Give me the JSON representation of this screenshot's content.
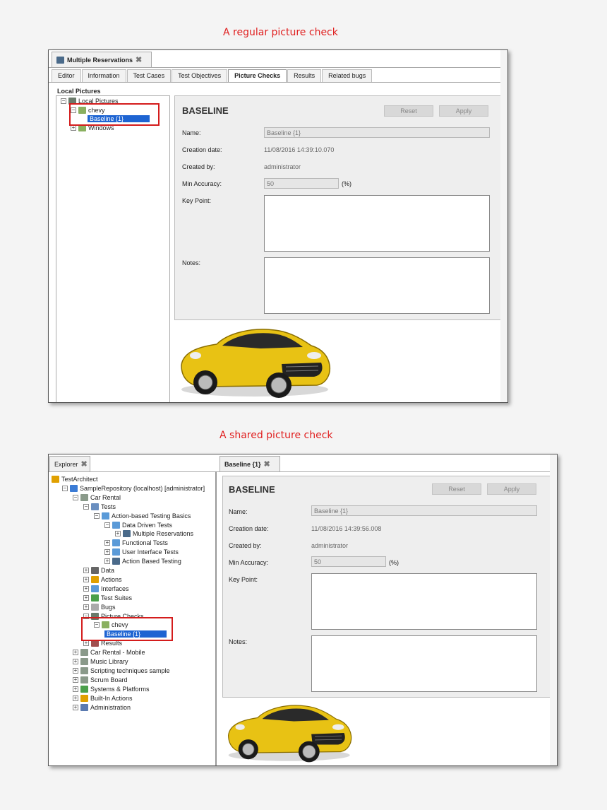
{
  "top": {
    "caption": "A regular picture check",
    "window_tab": "Multiple Reservations",
    "tabs": [
      "Editor",
      "Information",
      "Test Cases",
      "Test Objectives",
      "Picture Checks",
      "Results",
      "Related bugs"
    ],
    "active_tab": "Picture Checks",
    "panel_title": "Local Pictures",
    "tree": {
      "root": "Local Pictures",
      "folder": "chevy",
      "selected": "Baseline {1}",
      "other": "Windows"
    },
    "detail": {
      "heading": "BASELINE",
      "reset": "Reset",
      "apply": "Apply",
      "name_label": "Name:",
      "name_value": "Baseline {1}",
      "creation_label": "Creation date:",
      "creation_value": "11/08/2016 14:39:10.070",
      "created_by_label": "Created by:",
      "created_by_value": "administrator",
      "accuracy_label": "Min Accuracy:",
      "accuracy_value": "50",
      "percent": "(%)",
      "keypoint_label": "Key Point:",
      "notes_label": "Notes:"
    }
  },
  "bottom": {
    "caption": "A shared picture check",
    "explorer_tab": "Explorer",
    "editor_tab": "Baseline {1}",
    "tree": [
      {
        "label": "TestArchitect",
        "indent": 0,
        "icon": "pen-icon",
        "color": "#e0a000"
      },
      {
        "label": "SampleRepository (localhost) [administrator]",
        "indent": 1,
        "icon": "repository-icon",
        "color": "#3a7bd5"
      },
      {
        "label": "Car Rental",
        "indent": 2,
        "icon": "project-icon",
        "color": "#8a9a8a"
      },
      {
        "label": "Tests",
        "indent": 3,
        "icon": "tests-icon",
        "color": "#6a8fc0"
      },
      {
        "label": "Action-based Testing Basics",
        "indent": 4,
        "icon": "folder-icon",
        "color": "#5a9ad8"
      },
      {
        "label": "Data Driven Tests",
        "indent": 5,
        "icon": "folder-icon",
        "color": "#5a9ad8"
      },
      {
        "label": "Multiple Reservations",
        "indent": 6,
        "icon": "test-module-icon",
        "color": "#4a6a8a"
      },
      {
        "label": "Functional Tests",
        "indent": 5,
        "icon": "folder-icon",
        "color": "#5a9ad8"
      },
      {
        "label": "User Interface Tests",
        "indent": 5,
        "icon": "folder-icon",
        "color": "#5a9ad8"
      },
      {
        "label": "Action Based Testing",
        "indent": 5,
        "icon": "test-module-icon",
        "color": "#4a6a8a"
      },
      {
        "label": "Data",
        "indent": 3,
        "icon": "data-icon",
        "color": "#666666"
      },
      {
        "label": "Actions",
        "indent": 3,
        "icon": "actions-icon",
        "color": "#e0a000"
      },
      {
        "label": "Interfaces",
        "indent": 3,
        "icon": "interfaces-icon",
        "color": "#5a9ad8"
      },
      {
        "label": "Test Suites",
        "indent": 3,
        "icon": "test-suites-icon",
        "color": "#4aa04a"
      },
      {
        "label": "Bugs",
        "indent": 3,
        "icon": "bugs-icon",
        "color": "#aaaaaa"
      },
      {
        "label": "Picture Checks",
        "indent": 3,
        "icon": "picture-checks-icon",
        "color": "#6a7a6a"
      },
      {
        "label": "chevy",
        "indent": 4,
        "icon": "picture-folder-icon",
        "color": "#8ab060"
      },
      {
        "label": "Baseline {1}",
        "indent": 5,
        "icon": "",
        "color": ""
      },
      {
        "label": "Results",
        "indent": 3,
        "icon": "results-icon",
        "color": "#a05050"
      },
      {
        "label": "Car Rental - Mobile",
        "indent": 2,
        "icon": "project-icon",
        "color": "#8a9a8a"
      },
      {
        "label": "Music Library",
        "indent": 2,
        "icon": "project-icon",
        "color": "#8a9a8a"
      },
      {
        "label": "Scripting techniques sample",
        "indent": 2,
        "icon": "project-icon",
        "color": "#8a9a8a"
      },
      {
        "label": "Scrum Board",
        "indent": 2,
        "icon": "project-icon",
        "color": "#8a9a8a"
      },
      {
        "label": "Systems & Platforms",
        "indent": 2,
        "icon": "systems-icon",
        "color": "#4aa04a"
      },
      {
        "label": "Built-In Actions",
        "indent": 2,
        "icon": "builtin-actions-icon",
        "color": "#e0a000"
      },
      {
        "label": "Administration",
        "indent": 2,
        "icon": "administration-icon",
        "color": "#5a7ab0"
      }
    ],
    "detail": {
      "heading": "BASELINE",
      "reset": "Reset",
      "apply": "Apply",
      "name_label": "Name:",
      "name_value": "Baseline {1}",
      "creation_label": "Creation date:",
      "creation_value": "11/08/2016 14:39:56.008",
      "created_by_label": "Created by:",
      "created_by_value": "administrator",
      "accuracy_label": "Min Accuracy:",
      "accuracy_value": "50",
      "percent": "(%)",
      "keypoint_label": "Key Point:",
      "notes_label": "Notes:"
    }
  },
  "colors": {
    "caption": "#e02020",
    "selection": "#1e64d2",
    "highlight_box": "#d41c1c",
    "car": "#e8c214"
  }
}
